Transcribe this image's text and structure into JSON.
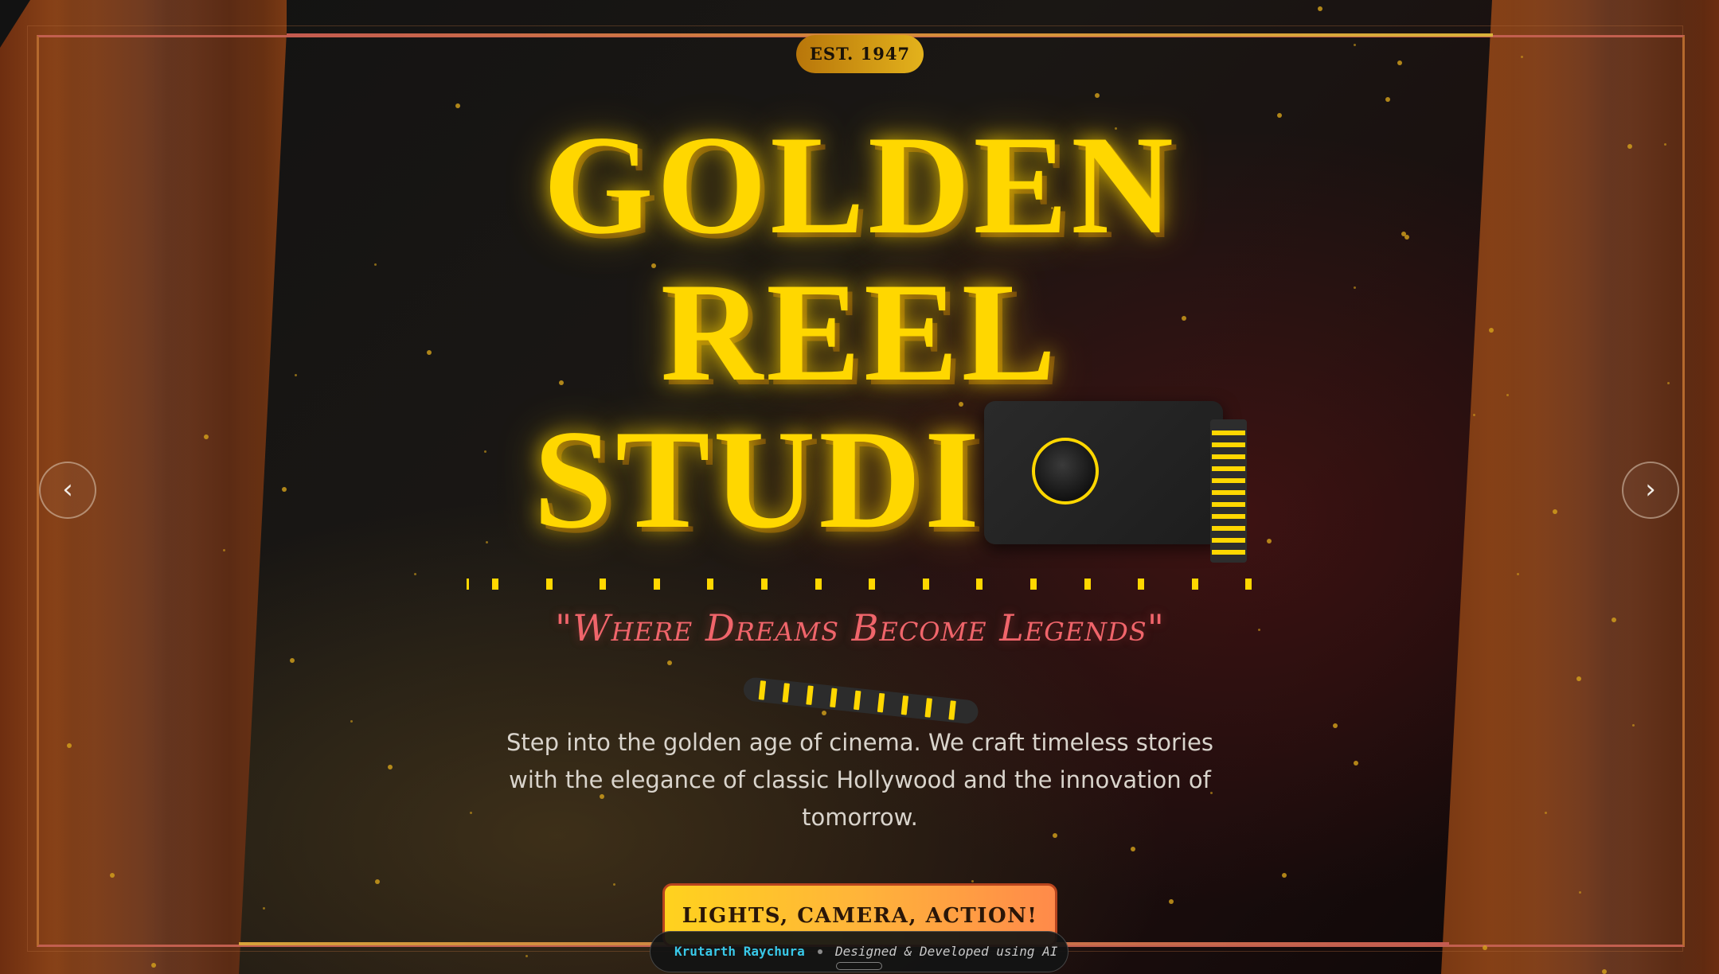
{
  "badge": {
    "est": "EST. 1947"
  },
  "hero": {
    "title_lines": [
      "GOLDEN",
      "REEL",
      "STUDI"
    ],
    "tagline": "\"Where Dreams Become Legends\"",
    "description": "Step into the golden age of cinema. We craft timeless stories with the elegance of classic Hollywood and the innovation of tomorrow.",
    "cta_label": "LIGHTS, CAMERA, ACTION!"
  },
  "nav": {
    "prev_label": "‹",
    "next_label": "›"
  },
  "credit": {
    "name": "Krutarth Raychura",
    "tagline": "Designed & Developed using AI"
  },
  "colors": {
    "accent_gold": "#ffd700",
    "tagline_red": "#f0656b",
    "curtain": "#8a4318",
    "credit_cyan": "#39c8e8"
  },
  "icons": [
    "camera-icon",
    "film-reel-icon",
    "chevron-left-icon",
    "chevron-right-icon"
  ]
}
